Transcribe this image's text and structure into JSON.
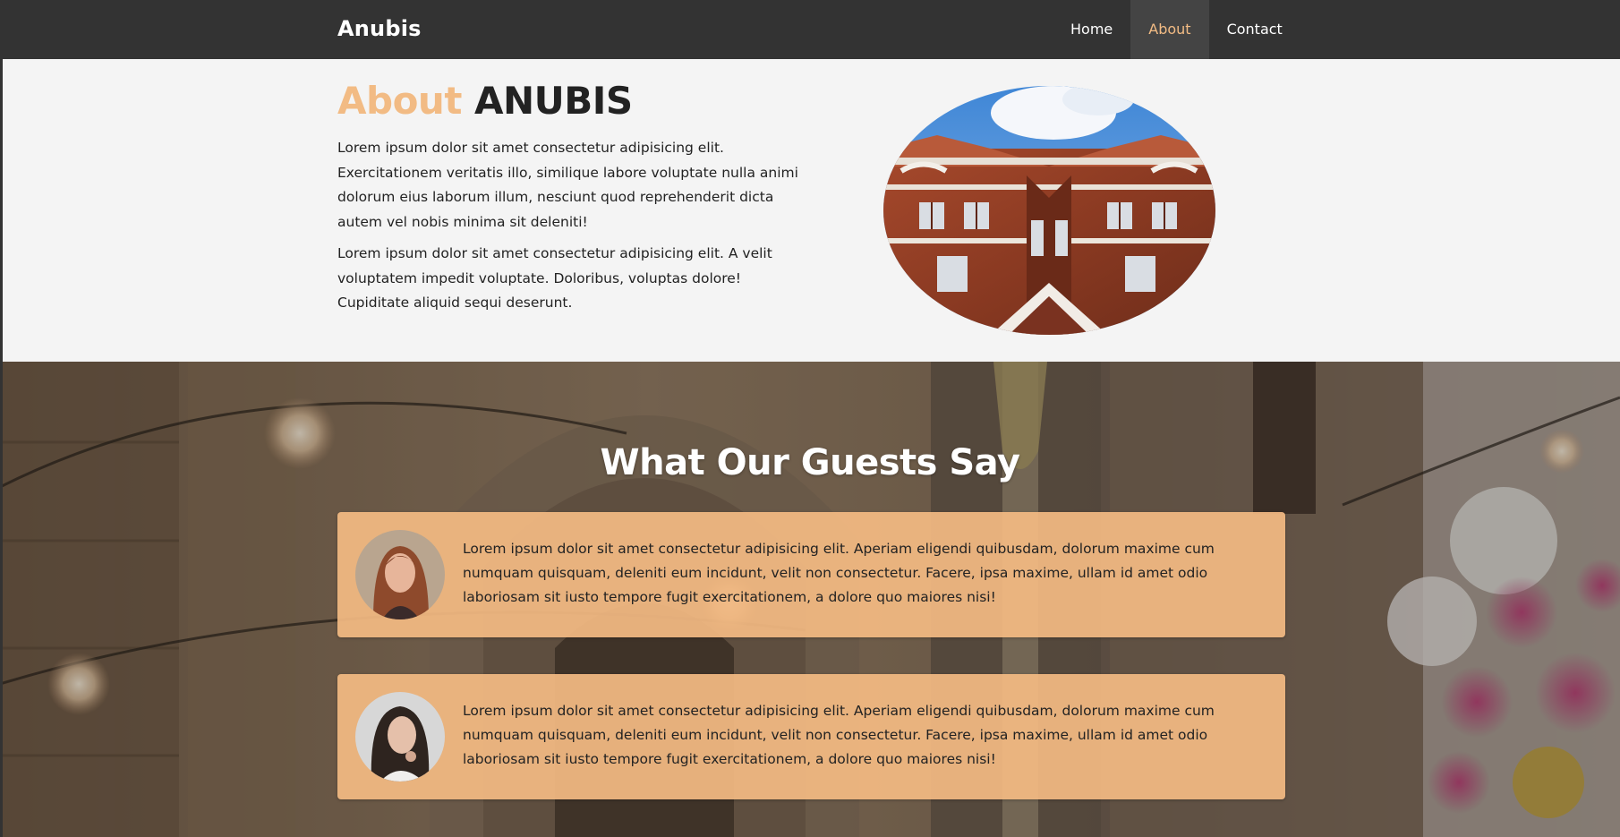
{
  "nav": {
    "brand": "Anubis",
    "links": [
      {
        "label": "Home",
        "active": false
      },
      {
        "label": "About",
        "active": true
      },
      {
        "label": "Contact",
        "active": false
      }
    ]
  },
  "about": {
    "title_accent": "About",
    "title_main": "ANUBIS",
    "paragraphs": [
      "Lorem ipsum dolor sit amet consectetur adipisicing elit. Exercitationem veritatis illo, similique labore voluptate nulla animi dolorum eius laborum illum, nesciunt quod reprehenderit dicta autem vel nobis minima sit deleniti!",
      "Lorem ipsum dolor sit amet consectetur adipisicing elit. A velit voluptatem impedit voluptate. Doloribus, voluptas dolore! Cupiditate aliquid sequi deserunt."
    ]
  },
  "testimonials": {
    "title": "What Our Guests Say",
    "items": [
      {
        "text": "Lorem ipsum dolor sit amet consectetur adipisicing elit. Aperiam eligendi quibusdam, dolorum maxime cum numquam quisquam, deleniti eum incidunt, velit non consectetur. Facere, ipsa maxime, ullam id amet odio laboriosam sit iusto tempore fugit exercitationem, a dolore quo maiores nisi!"
      },
      {
        "text": "Lorem ipsum dolor sit amet consectetur adipisicing elit. Aperiam eligendi quibusdam, dolorum maxime cum numquam quisquam, deleniti eum incidunt, velit non consectetur. Facere, ipsa maxime, ullam id amet odio laboriosam sit iusto tempore fugit exercitationem, a dolore quo maiores nisi!"
      }
    ]
  },
  "colors": {
    "nav_bg": "#333333",
    "accent": "#f2bb84",
    "about_bg": "#f4f4f4",
    "card_bg": "#f4bb83"
  }
}
